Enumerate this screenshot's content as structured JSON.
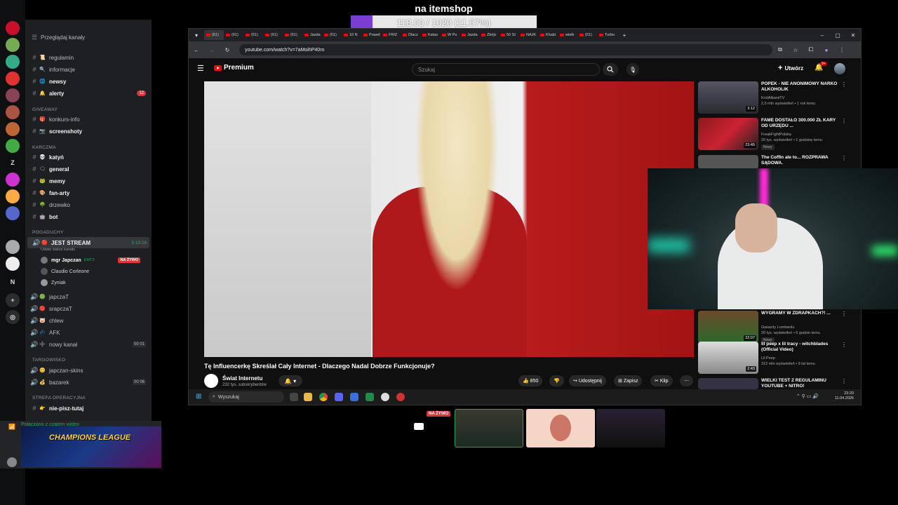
{
  "overlay": {
    "title": "na itemshop",
    "goal_text": "118.00 / 1020 (11.57%)",
    "goal_fraction": 0.1157,
    "goal_color": "#7c3ed1"
  },
  "discord": {
    "browse_label": "Przeglądaj kanały",
    "channels_top": [
      {
        "label": "regulamin",
        "bold": false
      },
      {
        "label": "informacje",
        "bold": false
      },
      {
        "label": "newsy",
        "bold": true
      },
      {
        "label": "alerty",
        "bold": true,
        "badge": "12"
      }
    ],
    "cat_giveaway": "GIVEAWAY",
    "giveaway": [
      {
        "label": "konkurs-info",
        "bold": false
      },
      {
        "label": "screenshoty",
        "bold": true
      }
    ],
    "cat_karczma": "KARCZMA",
    "karczma": [
      {
        "label": "katyń",
        "bold": true
      },
      {
        "label": "general",
        "bold": true
      },
      {
        "label": "memy",
        "bold": true
      },
      {
        "label": "fan-arty",
        "bold": true
      },
      {
        "label": "drzewko",
        "bold": false
      },
      {
        "label": "bot",
        "bold": true
      }
    ],
    "cat_pogaduchy": "POGADUCHY",
    "voice_active": {
      "label": "JEST STREAM",
      "time": "5:19:28",
      "status": "Ustaw status kanału"
    },
    "voice_users": [
      {
        "name": "mgr Japczan",
        "tag": "EMT2",
        "live": "NA ŻYWO"
      },
      {
        "name": "Claudio Corleone"
      },
      {
        "name": "Zyniak"
      }
    ],
    "voice_channels": [
      {
        "label": "japczaT"
      },
      {
        "label": "srapczaT"
      },
      {
        "label": "chlew"
      },
      {
        "label": "AFK"
      },
      {
        "label": "nowy kanał",
        "counts": "00 01"
      }
    ],
    "cat_targowisko": "TARGOWISKO",
    "targowisko": [
      {
        "label": "japczan-skins"
      },
      {
        "label": "bazarek",
        "counts": "00 06"
      }
    ],
    "cat_strefa": "STREFA OPERACYJNA",
    "strefa": [
      {
        "label": "nie-pisz-tutaj"
      }
    ],
    "connected_label": "Połączono z czatem wideo",
    "banner_text": "CHAMPIONS LEAGUE",
    "rail_letters": [
      "Z",
      "N"
    ]
  },
  "browser": {
    "url": "youtube.com/watch?v=7aMoihP40ro",
    "tabs": [
      "(61)",
      "(61) ",
      "(61) ",
      "(61) ",
      "(61) ",
      "Jazda",
      "(61) ",
      "10 N",
      "Prawd",
      "FRIZ",
      "Dlacz",
      "Katas",
      "W Po",
      "Jazda",
      "Zbójc",
      "50 St",
      "NAJK",
      "Khabi",
      "wielk",
      "(61) ",
      "Turbo"
    ]
  },
  "youtube": {
    "logo_text": "Premium",
    "search_placeholder": "Szukaj",
    "create_label": "Utwórz",
    "bell_badge": "9+",
    "video_title": "Tę Influencerkę Skreślał Cały Internet - Dlaczego Nadal Dobrze Funkcjonuje?",
    "channel_name": "Świat Internetu",
    "channel_subs": "232 tys. subskrybentów",
    "likes": "850",
    "share_label": "Udostępnij",
    "save_label": "Zapisz",
    "clip_label": "Klip",
    "recommendations": [
      {
        "title": "POPEK - NIE ANONIMOWY NARKO ALKOHOLIK",
        "channel": "KrólAlbaniiTV",
        "meta": "2,5 mln wyświetleń • 1 rok temu",
        "duration": "3:12",
        "new": ""
      },
      {
        "title": "FAME DOSTAŁO 300.000 ZŁ KARY OD URZĘDU ...",
        "channel": "FreakFightPolska",
        "meta": "20 tys. wyświetleń • 1 godzinę temu",
        "duration": "23:45",
        "new": "Nowy"
      },
      {
        "title": "The Coffin ale to... ROZPRAWA SĄDOWA.",
        "channel": "",
        "meta": "",
        "duration": "",
        "new": ""
      },
      {
        "title": "WYGRAMY W ZDRAPKACH?! ...",
        "channel": "Gwiazdy Lombardu",
        "meta": "20 tys. wyświetleń • 6 godzin temu",
        "duration": "22:07",
        "new": "Nowy"
      },
      {
        "title": "lil peep x lil tracy - witchblades (Official Video)",
        "channel": "Lil Peep",
        "meta": "312 mln wyświetleń • 9 lat temu",
        "duration": "2:43",
        "new": ""
      },
      {
        "title": "WIELKI TEST Z REGULAMINU YOUTUBE + NITRO!",
        "channel": "",
        "meta": "",
        "duration": "",
        "new": ""
      }
    ]
  },
  "taskbar": {
    "search_placeholder": "Wyszukaj",
    "time": "23:20",
    "date": "11.04.2026"
  },
  "streams": {
    "live_label": "NA ŻYWO"
  }
}
